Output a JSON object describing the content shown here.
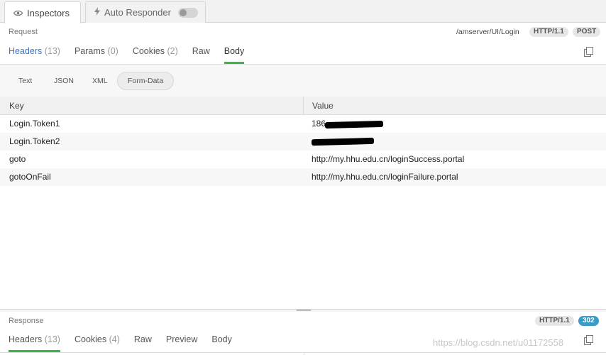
{
  "tabs": {
    "inspectors_label": "Inspectors",
    "auto_responder_label": "Auto Responder"
  },
  "request": {
    "section_label": "Request",
    "url": "/amserver/UI/Login",
    "http_version": "HTTP/1.1",
    "method": "POST",
    "subtabs": {
      "headers_label": "Headers",
      "headers_count": "(13)",
      "params_label": "Params",
      "params_count": "(0)",
      "cookies_label": "Cookies",
      "cookies_count": "(2)",
      "raw_label": "Raw",
      "body_label": "Body"
    },
    "formats": {
      "text": "Text",
      "json": "JSON",
      "xml": "XML",
      "form_data": "Form-Data"
    },
    "table": {
      "key_header": "Key",
      "value_header": "Value",
      "rows": [
        {
          "key": "Login.Token1",
          "value": "186"
        },
        {
          "key": "Login.Token2",
          "value": ""
        },
        {
          "key": "goto",
          "value": "http://my.hhu.edu.cn/loginSuccess.portal"
        },
        {
          "key": "gotoOnFail",
          "value": "http://my.hhu.edu.cn/loginFailure.portal"
        }
      ]
    }
  },
  "response": {
    "section_label": "Response",
    "http_version": "HTTP/1.1",
    "status": "302",
    "subtabs": {
      "headers_label": "Headers",
      "headers_count": "(13)",
      "cookies_label": "Cookies",
      "cookies_count": "(4)",
      "raw_label": "Raw",
      "preview_label": "Preview",
      "body_label": "Body"
    }
  },
  "watermark": "https://blog.csdn.net/u01172558",
  "colors": {
    "active_tab": "#3b74c7",
    "underline": "#39b54a",
    "status_badge": "#3b9bc7"
  },
  "icons": {
    "inspectors": "eye-icon",
    "auto_responder": "lightning-icon",
    "copy": "copy-icon"
  }
}
